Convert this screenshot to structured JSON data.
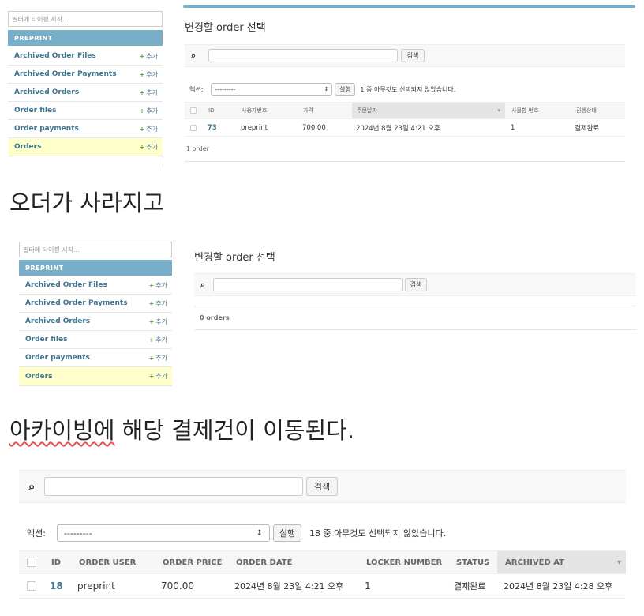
{
  "panel1": {
    "filter_placeholder": "필터에 타이핑 시작...",
    "app_header": "PREPRINT",
    "sidebar_items": [
      {
        "label": "Archived Order Files",
        "add": "추가"
      },
      {
        "label": "Archived Order Payments",
        "add": "추가"
      },
      {
        "label": "Archived Orders",
        "add": "추가"
      },
      {
        "label": "Order files",
        "add": "추가"
      },
      {
        "label": "Order payments",
        "add": "추가"
      },
      {
        "label": "Orders",
        "add": "추가",
        "selected": true
      }
    ],
    "title": "변경할 order 선택",
    "search_button": "검색",
    "action_label": "액션:",
    "action_value": "---------",
    "run_button": "실행",
    "selection_text": "1 중 아무것도 선택되지 않았습니다.",
    "columns": [
      "ID",
      "사용자번호",
      "가격",
      "주문날짜",
      "사물함 번호",
      "진행상태"
    ],
    "rows": [
      {
        "id": "73",
        "user": "preprint",
        "price": "700.00",
        "date": "2024년 8월 23일 4:21 오후",
        "locker": "1",
        "status": "결제완료"
      }
    ],
    "count": "1 order"
  },
  "caption1": "오더가 사라지고",
  "panel2": {
    "filter_placeholder": "필터에 타이핑 시작...",
    "app_header": "PREPRINT",
    "sidebar_items": [
      {
        "label": "Archived Order Files",
        "add": "추가"
      },
      {
        "label": "Archived Order Payments",
        "add": "추가"
      },
      {
        "label": "Archived Orders",
        "add": "추가"
      },
      {
        "label": "Order files",
        "add": "추가"
      },
      {
        "label": "Order payments",
        "add": "추가"
      },
      {
        "label": "Orders",
        "add": "추가",
        "selected": true
      }
    ],
    "title": "변경할 order 선택",
    "search_button": "검색",
    "count": "0 orders"
  },
  "caption2_word": "아카이빙에",
  "caption2_rest": " 해당 결제건이 이동된다.",
  "panel3": {
    "search_button": "검색",
    "action_label": "액션:",
    "action_value": "---------",
    "run_button": "실행",
    "selection_text": "18 중 아무것도 선택되지 않았습니다.",
    "columns": [
      "ID",
      "ORDER USER",
      "ORDER PRICE",
      "ORDER DATE",
      "LOCKER NUMBER",
      "STATUS",
      "ARCHIVED AT"
    ],
    "rows": [
      {
        "id": "18",
        "user": "preprint",
        "price": "700.00",
        "date": "2024년 8월 23일 4:21 오후",
        "locker": "1",
        "status": "결제완료",
        "archived": "2024년 8월 23일 4:28 오후"
      }
    ]
  },
  "colors": {
    "accent": "#79aec8",
    "link": "#417690",
    "add_plus": "#5c9b3a",
    "selected_row": "#ffffcc"
  }
}
